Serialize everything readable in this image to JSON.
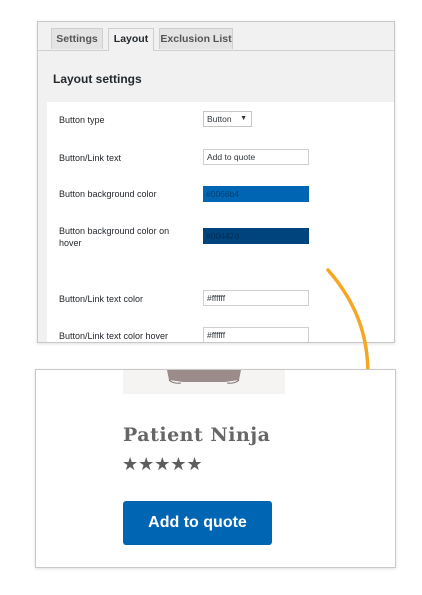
{
  "tabs": [
    {
      "label": "Settings",
      "active": false
    },
    {
      "label": "Layout",
      "active": true
    },
    {
      "label": "Exclusion List",
      "active": false
    }
  ],
  "panel": {
    "heading": "Layout settings",
    "fields": {
      "button_type": {
        "label": "Button type",
        "value": "Button",
        "caret": "▼"
      },
      "link_text": {
        "label": "Button/Link text",
        "value": "Add to quote"
      },
      "bg_color": {
        "label": "Button background color",
        "value": "#0066b4"
      },
      "bg_color_hover": {
        "label": "Button background color on hover",
        "value": "#00447d"
      },
      "text_color": {
        "label": "Button/Link text color",
        "value": "#ffffff"
      },
      "text_color_hover": {
        "label": "Button/Link text color hover",
        "value": "#ffffff"
      }
    }
  },
  "preview": {
    "product_title": "Patient Ninja",
    "rating": {
      "stars": "★★★★★",
      "value": 5,
      "max": 5
    },
    "button_label": "Add to quote"
  },
  "colors": {
    "button_bg": "#0066b4",
    "button_bg_hover": "#00447d",
    "button_text": "#ffffff",
    "arrow": "#f5a623"
  }
}
